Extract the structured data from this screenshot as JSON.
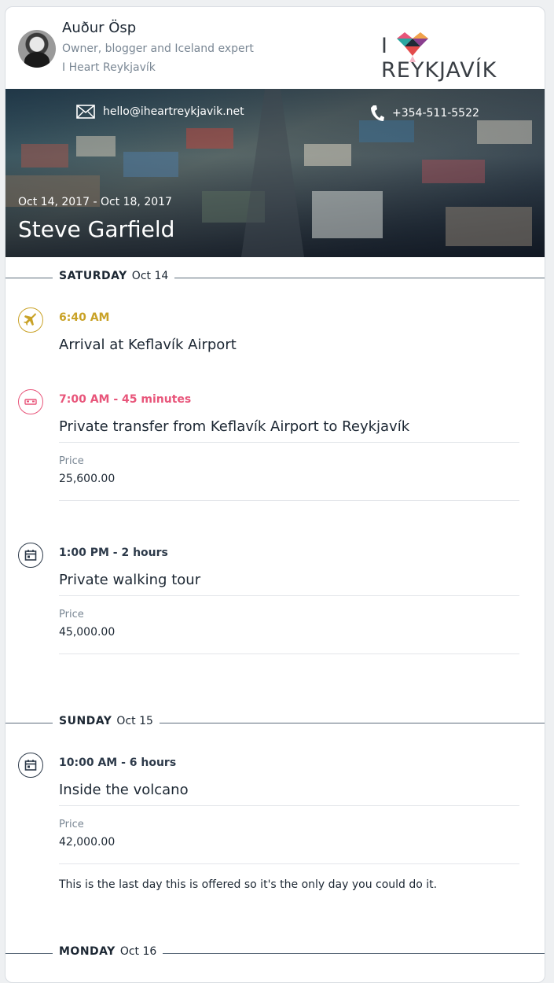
{
  "owner": {
    "name": "Auður Ösp",
    "role": "Owner, blogger and Iceland expert",
    "company": "I Heart Reykjavík"
  },
  "logo": {
    "left": "I",
    "right": "REYKJAVÍK"
  },
  "hero": {
    "email": "hello@iheartreykjavik.net",
    "phone": "+354-511-5522",
    "dates": "Oct 14, 2017 - Oct 18, 2017",
    "client": "Steve Garfield"
  },
  "colors": {
    "gold": "#c9a227",
    "pink": "#e8557a",
    "navy": "#2d3a4a"
  },
  "days": [
    {
      "weekday": "SATURDAY",
      "date": "Oct 14",
      "items": [
        {
          "icon": "airplane-icon",
          "time": "6:40 AM",
          "title": "Arrival at Keflavík Airport"
        },
        {
          "icon": "car-icon",
          "time": "7:00 AM - 45 minutes",
          "title": "Private transfer from Keflavík Airport to Reykjavík",
          "price_label": "Price",
          "price": "25,600.00"
        },
        {
          "icon": "calendar-icon",
          "time": "1:00 PM - 2 hours",
          "title": "Private walking tour",
          "price_label": "Price",
          "price": "45,000.00"
        }
      ]
    },
    {
      "weekday": "SUNDAY",
      "date": "Oct 15",
      "items": [
        {
          "icon": "calendar-icon",
          "time": "10:00 AM - 6 hours",
          "title": "Inside the volcano",
          "price_label": "Price",
          "price": "42,000.00",
          "note": "This is the last day this is offered so it's the only day you could do it."
        }
      ]
    },
    {
      "weekday": "MONDAY",
      "date": "Oct 16",
      "items": []
    }
  ]
}
